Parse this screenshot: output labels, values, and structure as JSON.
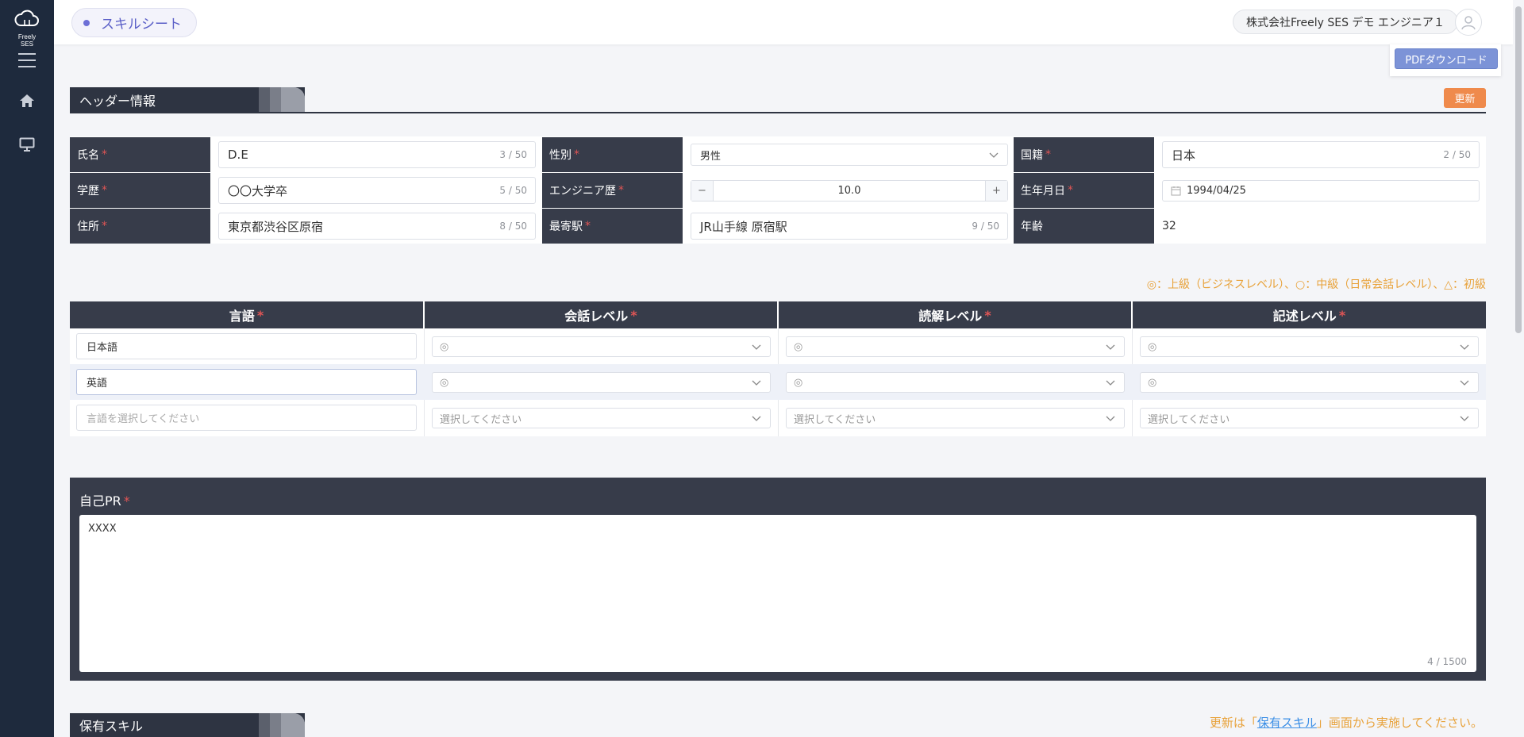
{
  "app": {
    "logo_text": "Freely SES"
  },
  "header": {
    "title": "スキルシート",
    "company_user": "株式会社Freely SES デモ エンジニア１",
    "pdf_button": "PDFダウンロード"
  },
  "header_info": {
    "section_title": "ヘッダー情報",
    "update_button": "更新",
    "fields": {
      "name": {
        "label": "氏名",
        "value": "D.E",
        "counter": "3 / 50"
      },
      "gender": {
        "label": "性別",
        "value": "男性"
      },
      "nationality": {
        "label": "国籍",
        "value": "日本",
        "counter": "2 / 50"
      },
      "education": {
        "label": "学歴",
        "value": "〇〇大学卒",
        "counter": "5 / 50"
      },
      "engineer_years": {
        "label": "エンジニア歴",
        "value": "10.0",
        "minus": "−",
        "plus": "+"
      },
      "birthday": {
        "label": "生年月日",
        "value": "1994/04/25"
      },
      "address": {
        "label": "住所",
        "value": "東京都渋谷区原宿",
        "counter": "8 / 50"
      },
      "station": {
        "label": "最寄駅",
        "value": "JR山手線 原宿駅",
        "counter": "9 / 50"
      },
      "age": {
        "label": "年齢",
        "value": "32"
      }
    }
  },
  "language": {
    "legend": "◎：上級（ビジネスレベル）、○：中級（日常会話レベル）、△：初級",
    "headers": {
      "language": "言語",
      "speaking": "会話レベル",
      "reading": "読解レベル",
      "writing": "記述レベル"
    },
    "rows": [
      {
        "language": "日本語",
        "speaking": "◎",
        "reading": "◎",
        "writing": "◎"
      },
      {
        "language": "英語",
        "speaking": "◎",
        "reading": "◎",
        "writing": "◎"
      }
    ],
    "new_row": {
      "language_placeholder": "言語を選択してください",
      "select_placeholder": "選択してください"
    }
  },
  "self_pr": {
    "label": "自己PR",
    "value": "XXXX",
    "counter": "4 / 1500"
  },
  "skills": {
    "section_title": "保有スキル",
    "note_before": "更新は「",
    "note_link": "保有スキル",
    "note_after": "」画面から実施してください。"
  },
  "colors": {
    "sidebar": "#1e2a3d",
    "section_header": "#2e3442",
    "accent_orange": "#ef8a4c",
    "pdf_button": "#7c93d7",
    "required": "#e05555",
    "legend_text": "#e8a23a"
  }
}
